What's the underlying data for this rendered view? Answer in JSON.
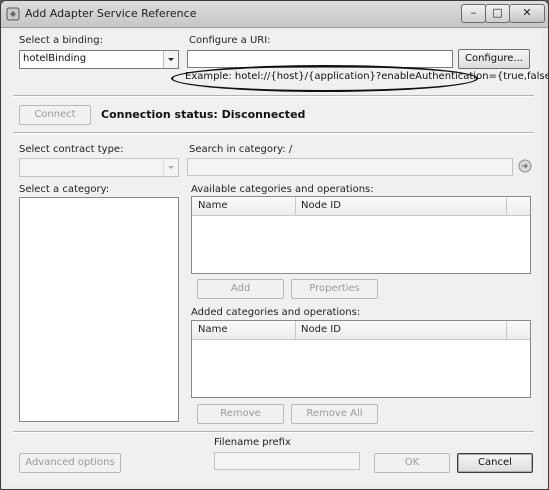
{
  "window": {
    "title": "Add Adapter Service Reference",
    "controls": {
      "minimize": "–",
      "maximize": "□",
      "close": "✕"
    }
  },
  "binding": {
    "label": "Select a binding:",
    "value": "hotelBinding"
  },
  "uri": {
    "label": "Configure a URI:",
    "value": "",
    "configure_button": "Configure...",
    "example": "Example: hotel://{host}/{application}?enableAuthentication={true,false}"
  },
  "connection": {
    "connect_button": "Connect",
    "status_label": "Connection status:",
    "status_value": "Disconnected"
  },
  "contract": {
    "label": "Select contract type:",
    "value": ""
  },
  "search": {
    "label": "Search in category: /",
    "value": "",
    "icon": "go-icon"
  },
  "category": {
    "label": "Select a category:"
  },
  "available": {
    "label": "Available categories and operations:",
    "columns": [
      "Name",
      "Node ID"
    ],
    "add_button": "Add",
    "properties_button": "Properties"
  },
  "added": {
    "label": "Added categories and operations:",
    "columns": [
      "Name",
      "Node ID"
    ],
    "remove_button": "Remove",
    "remove_all_button": "Remove All"
  },
  "footer": {
    "advanced_button": "Advanced options",
    "filename_label": "Filename prefix",
    "filename_value": "",
    "ok_button": "OK",
    "cancel_button": "Cancel"
  }
}
